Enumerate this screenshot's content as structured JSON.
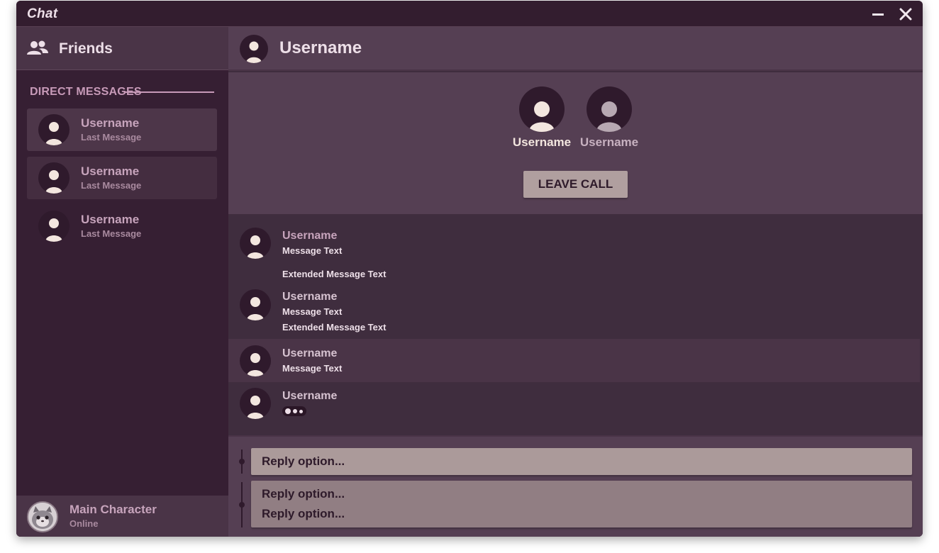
{
  "window": {
    "title": "Chat"
  },
  "sidebar": {
    "friends_label": "Friends",
    "dm_heading": "DIRECT MESSAGES",
    "conversations": [
      {
        "username": "Username",
        "last_message": "Last Message",
        "state": "active"
      },
      {
        "username": "Username",
        "last_message": "Last Message",
        "state": "hover"
      },
      {
        "username": "Username",
        "last_message": "Last Message",
        "state": "default"
      }
    ],
    "me": {
      "name": "Main Character",
      "status": "Online"
    }
  },
  "chat": {
    "header_username": "Username",
    "call": {
      "participants": [
        {
          "username": "Username",
          "speaking": true
        },
        {
          "username": "Username",
          "speaking": false
        }
      ],
      "leave_label": "LEAVE CALL"
    },
    "messages": [
      {
        "username": "Username",
        "lines": [
          "Message Text",
          "Extended Message Text"
        ]
      },
      {
        "username": "Username",
        "lines": [
          "Message Text",
          "Extended Message Text"
        ]
      },
      {
        "username": "Username",
        "lines": [
          "Message Text"
        ]
      },
      {
        "username": "Username",
        "typing": true
      }
    ],
    "reply_options": [
      {
        "label": "Reply option..."
      },
      {
        "label": "Reply option..."
      },
      {
        "label": "Reply option..."
      }
    ]
  },
  "colors": {
    "window_bg": "#3f2d3e",
    "sidebar_bg": "#361f33",
    "header_bg": "#553f53",
    "accent_text": "#eddfe8",
    "muted_text": "#c7a4bc",
    "button_bg": "#b09f9f"
  }
}
